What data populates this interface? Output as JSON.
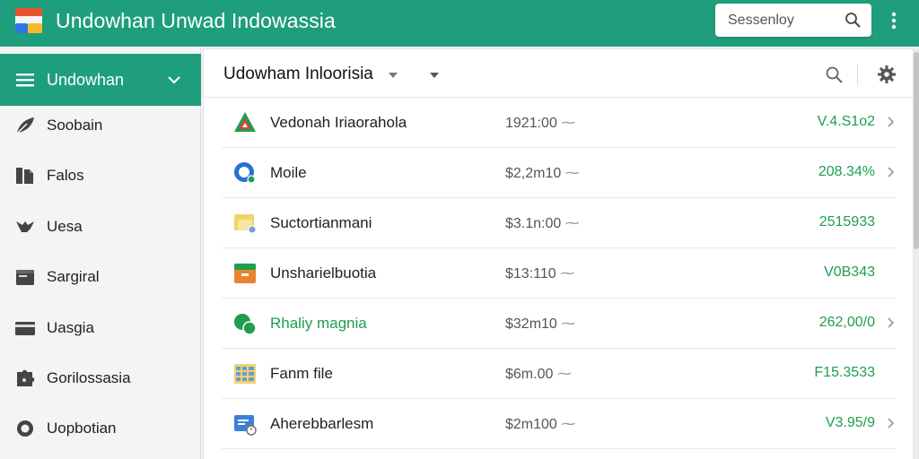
{
  "appbar": {
    "title": "Undowhan Unwad Indowassia",
    "search_placeholder": "Sessenloy"
  },
  "sidebar": {
    "header_label": "Undowhan",
    "items": [
      {
        "label": "Soobain",
        "icon": "leaf-icon"
      },
      {
        "label": "Falos",
        "icon": "files-icon"
      },
      {
        "label": "Uesa",
        "icon": "bird-icon"
      },
      {
        "label": "Sargiral",
        "icon": "folder-icon"
      },
      {
        "label": "Uasgia",
        "icon": "card-icon"
      },
      {
        "label": "Gorilossasia",
        "icon": "puzzle-icon"
      },
      {
        "label": "Uopbotian",
        "icon": "ring-icon"
      }
    ]
  },
  "main": {
    "title": "Udowham Inloorisia",
    "rows": [
      {
        "name": "Vedonah Iriaorahola",
        "value": "1921:00",
        "amount": "V.4.S1o2",
        "icon": "drive-icon",
        "chevron": true,
        "name_green": false
      },
      {
        "name": "Moile",
        "value": "$2,2m10",
        "amount": "208.34%",
        "icon": "globe-icon",
        "chevron": true,
        "name_green": false
      },
      {
        "name": "Suctortianmani",
        "value": "$3.1n:00",
        "amount": "2515933",
        "icon": "folder-file-icon",
        "chevron": false,
        "name_green": false
      },
      {
        "name": "Unsharielbuotia",
        "value": "$13:110",
        "amount": "V0B343",
        "icon": "box-icon",
        "chevron": false,
        "name_green": false
      },
      {
        "name": "Rhaliy magnia",
        "value": "$32m10",
        "amount": "262,00/0",
        "icon": "chat-icon",
        "chevron": true,
        "name_green": true
      },
      {
        "name": "Fanm file",
        "value": "$6m.00",
        "amount": "F15.3533",
        "icon": "spreadsheet-icon",
        "chevron": false,
        "name_green": false
      },
      {
        "name": "Aherebbarlesm",
        "value": "$2m100",
        "amount": "V3.95/9",
        "icon": "document-clock-icon",
        "chevron": true,
        "name_green": false
      }
    ]
  },
  "colors": {
    "brand": "#1e9e7c",
    "amount_green": "#1e9e4e"
  }
}
